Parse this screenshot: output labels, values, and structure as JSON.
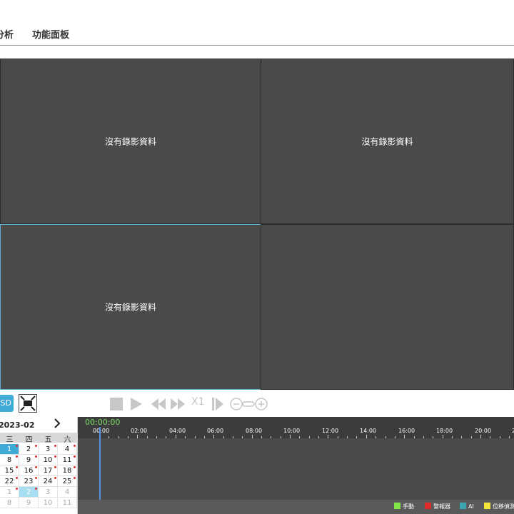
{
  "nav": {
    "tab1": "分析",
    "tab2": "功能面板"
  },
  "grid": {
    "no_record": "沒有錄影資料"
  },
  "toolbar": {
    "osd_label": "OSD",
    "speed_label": "X1"
  },
  "calendar": {
    "month": "2023-02",
    "weekdays": [
      "三",
      "四",
      "五",
      "六"
    ],
    "rows": [
      [
        "1",
        "2",
        "3",
        "4"
      ],
      [
        "8",
        "9",
        "10",
        "11"
      ],
      [
        "15",
        "16",
        "17",
        "18"
      ],
      [
        "22",
        "23",
        "24",
        "25"
      ],
      [
        "1",
        "2",
        "3",
        "4"
      ],
      [
        "8",
        "9",
        "10",
        "11"
      ]
    ]
  },
  "timeline": {
    "current_time": "00:00:00",
    "ticks": [
      "00:00",
      "02:00",
      "04:00",
      "06:00",
      "08:00",
      "10:00",
      "12:00",
      "14:00",
      "16:00",
      "18:00",
      "20:00",
      "2"
    ],
    "legend": [
      {
        "label": "手動",
        "color": "#7fe64a"
      },
      {
        "label": "警報器",
        "color": "#e02b2b"
      },
      {
        "label": "AI",
        "color": "#3aa6b0"
      },
      {
        "label": "位移偵測",
        "color": "#f5e43a"
      }
    ]
  },
  "colors": {
    "accent": "#3eaad6",
    "cell_bg": "#4a4a4a",
    "timeline_bg": "#4b4b4b",
    "time_text": "#7ee06a"
  }
}
